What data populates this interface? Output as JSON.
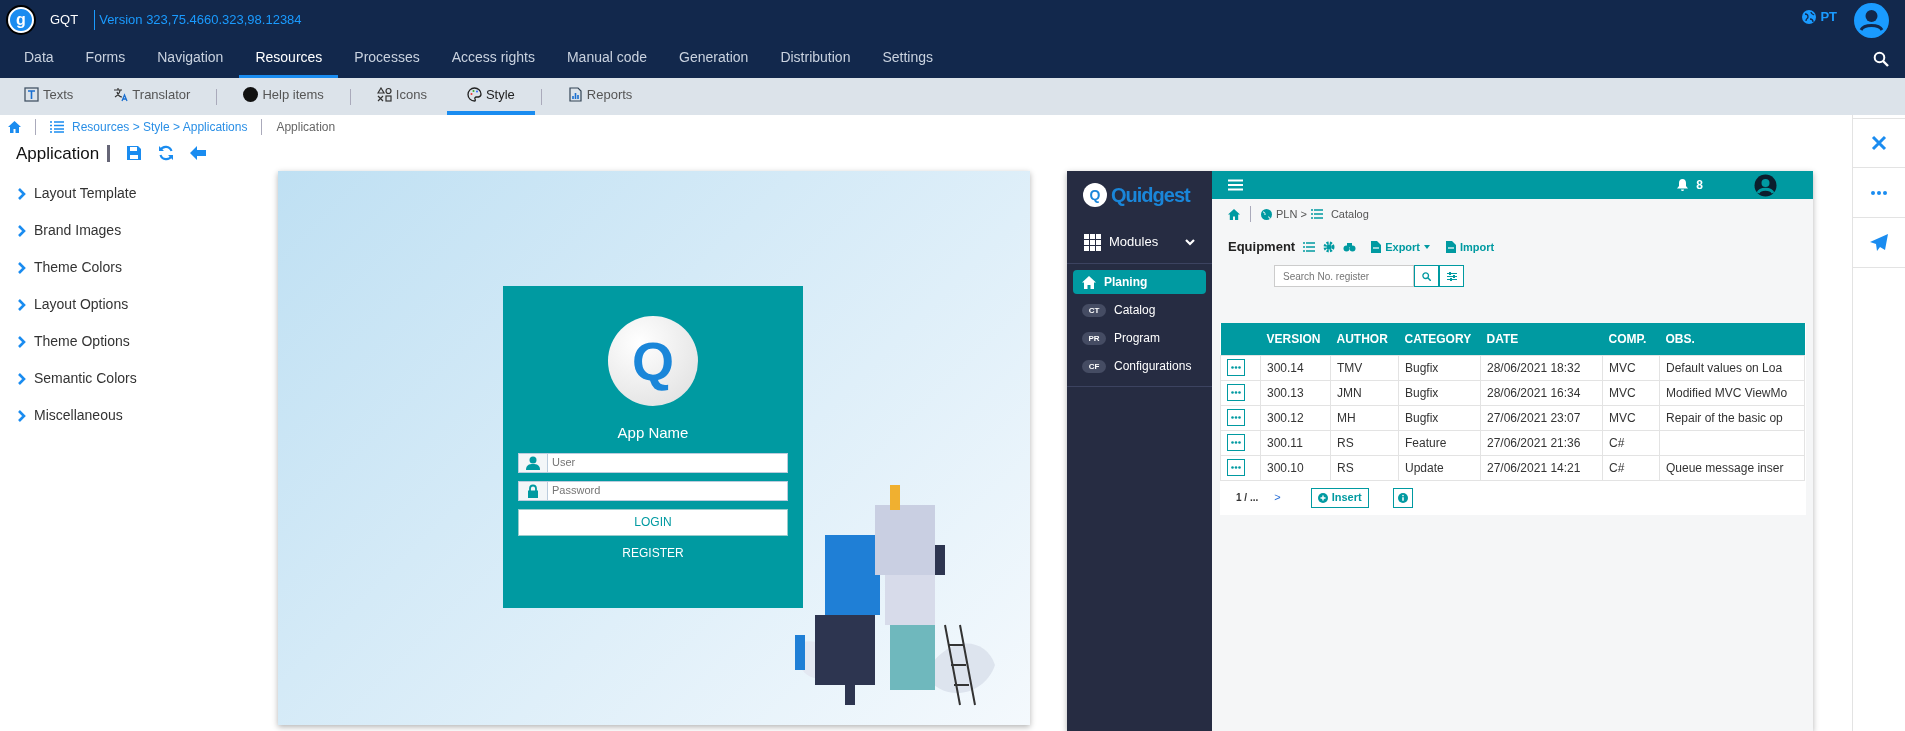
{
  "header": {
    "logo_glyph": "g",
    "app": "GQT",
    "version": "Version 323,75.4660.323,98.12384",
    "language": "PT"
  },
  "main_tabs": [
    {
      "label": "Data",
      "selected": false
    },
    {
      "label": "Forms",
      "selected": false
    },
    {
      "label": "Navigation",
      "selected": false
    },
    {
      "label": "Resources",
      "selected": true
    },
    {
      "label": "Processes",
      "selected": false
    },
    {
      "label": "Access rights",
      "selected": false
    },
    {
      "label": "Manual code",
      "selected": false
    },
    {
      "label": "Generation",
      "selected": false
    },
    {
      "label": "Distribution",
      "selected": false
    },
    {
      "label": "Settings",
      "selected": false
    }
  ],
  "sub_tab_groups": [
    [
      {
        "label": "Texts",
        "kind": "texts",
        "selected": false
      },
      {
        "label": "Translator",
        "kind": "translator",
        "selected": false
      }
    ],
    [
      {
        "label": "Help items",
        "kind": "help",
        "selected": false
      }
    ],
    [
      {
        "label": "Icons",
        "kind": "icons",
        "selected": false
      },
      {
        "label": "Style",
        "kind": "style",
        "selected": true
      }
    ],
    [
      {
        "label": "Reports",
        "kind": "reports",
        "selected": false
      }
    ]
  ],
  "breadcrumb": {
    "path": "Resources > Style > Applications",
    "current": "Application"
  },
  "page_title": "Application",
  "sections": [
    {
      "label": "Layout Template",
      "expanded": false
    },
    {
      "label": "Brand Images",
      "expanded": false
    },
    {
      "label": "Theme Colors",
      "expanded": false
    },
    {
      "label": "Layout Options",
      "expanded": false
    },
    {
      "label": "Theme Options",
      "expanded": false
    },
    {
      "label": "Semantic Colors",
      "expanded": false
    },
    {
      "label": "Miscellaneous",
      "expanded": false
    }
  ],
  "login_preview": {
    "logo_glyph": "Q",
    "app_name": "App Name",
    "user_placeholder": "User",
    "password_placeholder": "Password",
    "login": "LOGIN",
    "register": "REGISTER"
  },
  "app_preview": {
    "brand_glyph": "Q",
    "brand": "Quidgest",
    "notifications": "8",
    "breadcrumb": "PLN >",
    "breadcrumb_current": "Catalog",
    "menu_title": "Modules",
    "menu": [
      {
        "label": "Planing",
        "selected": true
      },
      {
        "label": "Catalog",
        "badge": "CT",
        "selected": false
      },
      {
        "label": "Program",
        "badge": "PR",
        "selected": false
      },
      {
        "label": "Configurations",
        "badge": "CF",
        "selected": false
      }
    ],
    "title": "Equipment",
    "export": "Export",
    "import": "Import",
    "search_placeholder": "Search No. register",
    "columns": [
      "VERSION",
      "AUTHOR",
      "CATEGORY",
      "DATE",
      "COMP.",
      "OBS."
    ],
    "rows": [
      [
        "300.14",
        "TMV",
        "Bugfix",
        "28/06/2021 18:32",
        "MVC",
        "Default values on Loa"
      ],
      [
        "300.13",
        "JMN",
        "Bugfix",
        "28/06/2021 16:34",
        "MVC",
        "Modified MVC ViewMo"
      ],
      [
        "300.12",
        "MH",
        "Bugfix",
        "27/06/2021 23:07",
        "MVC",
        "Repair of the basic op"
      ],
      [
        "300.11",
        "RS",
        "Feature",
        "27/06/2021 21:36",
        "C#"
      ],
      [
        "300.10",
        "RS",
        "Update",
        "27/06/2021 14:21",
        "C#",
        "Queue message inser"
      ]
    ],
    "pager": "1 / ...",
    "next": ">",
    "insert": "Insert"
  }
}
